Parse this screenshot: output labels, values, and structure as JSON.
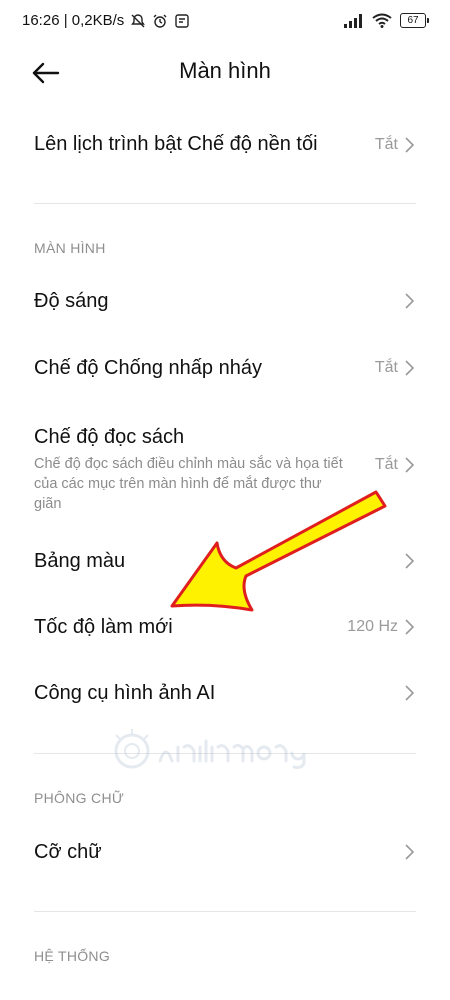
{
  "status_bar": {
    "time_and_speed": "16:26 | 0,2KB/s",
    "battery_level": "67"
  },
  "header": {
    "title": "Màn hình"
  },
  "rows": {
    "dark_mode_schedule": {
      "title": "Lên lịch trình bật Chế độ nền tối",
      "value": "Tắt"
    },
    "brightness": {
      "title": "Độ sáng"
    },
    "anti_flicker": {
      "title": "Chế độ Chống nhấp nháy",
      "value": "Tắt"
    },
    "reading_mode": {
      "title": "Chế độ đọc sách",
      "description": "Chế độ đọc sách điều chỉnh màu sắc và họa tiết của các mục trên màn hình để mắt được thư giãn",
      "value": "Tắt"
    },
    "color_palette": {
      "title": "Bảng màu"
    },
    "refresh_rate": {
      "title": "Tốc độ làm mới",
      "value": "120 Hz"
    },
    "ai_image_tools": {
      "title": "Công cụ hình ảnh AI"
    },
    "font_size": {
      "title": "Cỡ chữ"
    }
  },
  "sections": {
    "display": "MÀN HÌNH",
    "font": "PHÔNG CHỮ",
    "system": "HỆ THỐNG"
  },
  "colors": {
    "arrow_fill": "#FFF200",
    "arrow_stroke": "#E01E1E",
    "secondary_text": "#8C8C8C",
    "divider": "#E6E6E6"
  }
}
